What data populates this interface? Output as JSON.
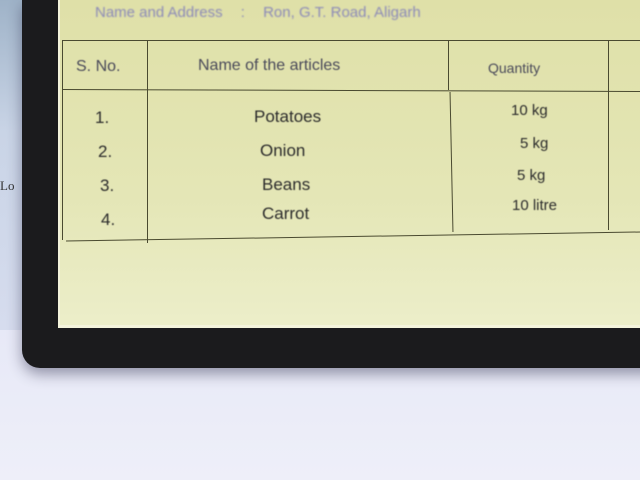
{
  "header": {
    "name_label": "Name and Address",
    "name_separator": ":",
    "name_value": "Ron, G.T. Road, Aligarh"
  },
  "columns": [
    "S. No.",
    "Name of the articles",
    "Quantity"
  ],
  "rows": [
    {
      "sno": "1.",
      "article": "Potatoes",
      "quantity": "10 kg"
    },
    {
      "sno": "2.",
      "article": "Onion",
      "quantity": "5 kg"
    },
    {
      "sno": "3.",
      "article": "Beans",
      "quantity": "5 kg"
    },
    {
      "sno": "4.",
      "article": "Carrot",
      "quantity": "10 litre"
    }
  ],
  "left_fragment": "Lo"
}
